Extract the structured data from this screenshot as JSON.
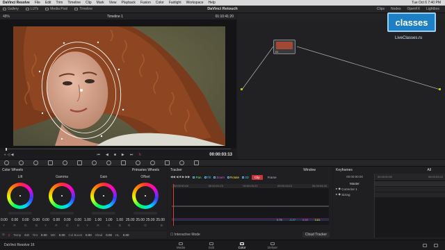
{
  "menubar": {
    "app_name": "DaVinci Resolve",
    "items": [
      "File",
      "Edit",
      "Trim",
      "Timeline",
      "Clip",
      "Mark",
      "View",
      "Playback",
      "Fusion",
      "Color",
      "Fairlight",
      "Workspace",
      "Help"
    ],
    "clock": "Tue Oct 6  7:40 PM"
  },
  "toolbar": {
    "title": "DaVinci Retouch",
    "left_items": [
      "Gallery",
      "LUTs",
      "Media Pool",
      "Timeline"
    ],
    "right_items": [
      "Clips",
      "Nodes",
      "OpenFX",
      "Lightbox"
    ]
  },
  "viewer": {
    "zoom": "48%",
    "timeline_name": "Timeline 1",
    "header_timecode": "01:10:41:20",
    "transport_timecode": "00:00:03:13"
  },
  "node": {
    "label": "01"
  },
  "watermark": {
    "logo": "classes",
    "site": "LiveClasses.ru"
  },
  "color_wheels": {
    "panel_title": "Color Wheels",
    "mode": "Primaries Wheels",
    "wheels": [
      {
        "name": "Lift",
        "values": [
          "0.00",
          "0.00",
          "0.00",
          "0.00"
        ],
        "labels": [
          "Y",
          "R",
          "G",
          "B"
        ]
      },
      {
        "name": "Gamma",
        "values": [
          "0.00",
          "0.00",
          "0.00",
          "0.00"
        ],
        "labels": [
          "Y",
          "R",
          "G",
          "B"
        ]
      },
      {
        "name": "Gain",
        "values": [
          "1.00",
          "1.00",
          "1.00",
          "1.00"
        ],
        "labels": [
          "Y",
          "R",
          "G",
          "B"
        ]
      },
      {
        "name": "Offset",
        "values": [
          "25.00",
          "25.00",
          "25.00",
          "25.00"
        ],
        "labels": [
          "R",
          "G",
          "B"
        ]
      }
    ],
    "adjust": [
      {
        "label": "Temp",
        "value": "0.0"
      },
      {
        "label": "Tint",
        "value": "0.00"
      },
      {
        "label": "MD",
        "value": "0.00"
      },
      {
        "label": "Col Boost",
        "value": "0.00"
      },
      {
        "label": "Shad",
        "value": "0.00"
      },
      {
        "label": "HL",
        "value": "0.00"
      }
    ],
    "page_num": "2"
  },
  "tracker": {
    "title": "Tracker",
    "window": "Window",
    "options": [
      "Pan",
      "Tilt",
      "Zoom",
      "Rotate",
      "3D"
    ],
    "clip_btn": "Clip",
    "frame_btn": "Frame",
    "ruler": [
      "00:00:00:00",
      "00:00:01:23",
      "00:00:03:22",
      "00:00:03:21",
      "00:00:04:20"
    ],
    "readout": [
      "0.75",
      "-4.27",
      "0.98",
      "0.81"
    ],
    "interactive_mode": "Interactive Mode",
    "cloud_tracker": "Cloud Tracker"
  },
  "keyframes": {
    "title": "Keyframes",
    "all": "All",
    "timecode": "00:00:00:00",
    "ruler_start": "00:00:00:00",
    "ruler_end": "00:00:03:22",
    "rows": [
      "Master",
      "Corrector 1",
      "Sizing"
    ]
  },
  "pagebar": {
    "app_label": "DaVinci Resolve 16",
    "pages": [
      "Media",
      "Edit",
      "Color",
      "Deliver"
    ],
    "active": "Color"
  }
}
